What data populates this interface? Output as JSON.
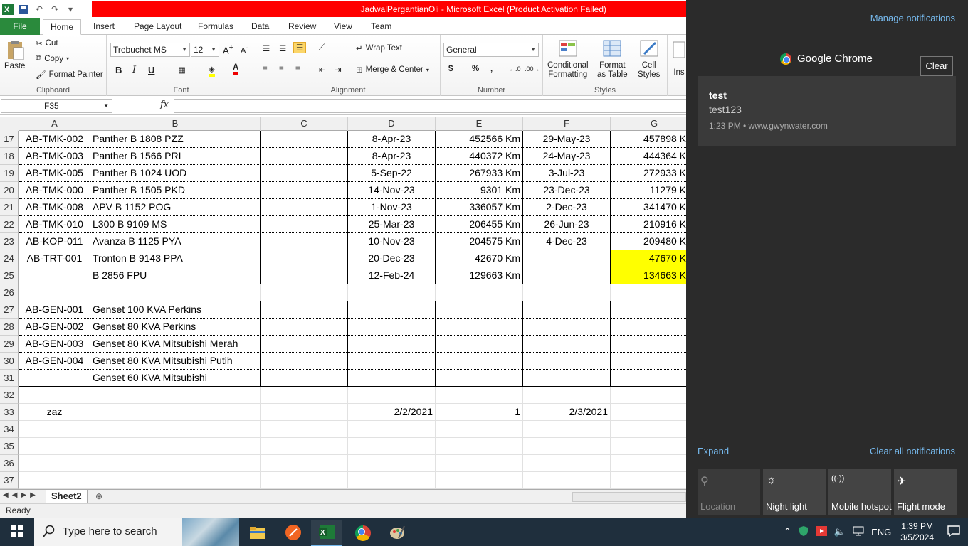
{
  "excel": {
    "title": "JadwalPergantianOli  -  Microsoft Excel (Product Activation Failed)",
    "tabs": [
      "File",
      "Home",
      "Insert",
      "Page Layout",
      "Formulas",
      "Data",
      "Review",
      "View",
      "Team"
    ],
    "clipboard": {
      "paste": "Paste",
      "cut": "Cut",
      "copy": "Copy",
      "format_painter": "Format Painter",
      "label": "Clipboard"
    },
    "font": {
      "family": "Trebuchet MS",
      "size": "12",
      "label": "Font"
    },
    "alignment": {
      "wrap": "Wrap Text",
      "merge": "Merge & Center",
      "label": "Alignment"
    },
    "number": {
      "format": "General",
      "label": "Number"
    },
    "styles": {
      "conditional": "Conditional",
      "formatting": "Formatting",
      "format_as": "Format",
      "as_table": "as Table",
      "cell": "Cell",
      "cell_styles": "Styles",
      "label": "Styles",
      "ins": "Ins"
    },
    "name_box": "F35",
    "fx": "fx",
    "columns": [
      "A",
      "B",
      "C",
      "D",
      "E",
      "F",
      "G"
    ],
    "rows": [
      {
        "n": "17",
        "a": "AB-TMK-002",
        "b": "Panther B 1808 PZZ",
        "c": "",
        "d": "8-Apr-23",
        "e": "452566 Km",
        "f": "29-May-23",
        "g": "457898 K",
        "hl": false,
        "boxed": true
      },
      {
        "n": "18",
        "a": "AB-TMK-003",
        "b": "Panther B 1566 PRI",
        "c": "",
        "d": "8-Apr-23",
        "e": "440372 Km",
        "f": "24-May-23",
        "g": "444364 K",
        "hl": false,
        "boxed": true
      },
      {
        "n": "19",
        "a": "AB-TMK-005",
        "b": "Panther B 1024 UOD",
        "c": "",
        "d": "5-Sep-22",
        "e": "267933 Km",
        "f": "3-Jul-23",
        "g": "272933 K",
        "hl": false,
        "boxed": true
      },
      {
        "n": "20",
        "a": "AB-TMK-000",
        "b": "Panther B 1505 PKD",
        "c": "",
        "d": "14-Nov-23",
        "e": "9301 Km",
        "f": "23-Dec-23",
        "g": "11279 K",
        "hl": false,
        "boxed": true
      },
      {
        "n": "21",
        "a": "AB-TMK-008",
        "b": "APV B 1152 POG",
        "c": "",
        "d": "1-Nov-23",
        "e": "336057 Km",
        "f": "2-Dec-23",
        "g": "341470 K",
        "hl": false,
        "boxed": true
      },
      {
        "n": "22",
        "a": "AB-TMK-010",
        "b": "L300 B 9109 MS",
        "c": "",
        "d": "25-Mar-23",
        "e": "206455 Km",
        "f": "26-Jun-23",
        "g": "210916 K",
        "hl": false,
        "boxed": true
      },
      {
        "n": "23",
        "a": "AB-KOP-011",
        "b": "Avanza B 1125 PYA",
        "c": "",
        "d": "10-Nov-23",
        "e": "204575 Km",
        "f": "4-Dec-23",
        "g": "209480 K",
        "hl": false,
        "boxed": true
      },
      {
        "n": "24",
        "a": "AB-TRT-001",
        "b": "Tronton B 9143 PPA",
        "c": "",
        "d": "20-Dec-23",
        "e": "42670 Km",
        "f": "",
        "g": "47670 K",
        "hl": true,
        "boxed": true
      },
      {
        "n": "25",
        "a": "",
        "b": "B 2856 FPU",
        "c": "",
        "d": "12-Feb-24",
        "e": "129663 Km",
        "f": "",
        "g": "134663 K",
        "hl": true,
        "boxed": true,
        "last": true
      },
      {
        "n": "26",
        "a": "",
        "b": "",
        "c": "",
        "d": "",
        "e": "",
        "f": "",
        "g": "",
        "hl": false,
        "boxed": false
      },
      {
        "n": "27",
        "a": "AB-GEN-001",
        "b": "Genset 100 KVA Perkins",
        "c": "",
        "d": "",
        "e": "",
        "f": "",
        "g": "",
        "hl": false,
        "boxed": true
      },
      {
        "n": "28",
        "a": "AB-GEN-002",
        "b": "Genset 80 KVA Perkins",
        "c": "",
        "d": "",
        "e": "",
        "f": "",
        "g": "",
        "hl": false,
        "boxed": true
      },
      {
        "n": "29",
        "a": "AB-GEN-003",
        "b": "Genset 80 KVA Mitsubishi Merah",
        "c": "",
        "d": "",
        "e": "",
        "f": "",
        "g": "",
        "hl": false,
        "boxed": true
      },
      {
        "n": "30",
        "a": "AB-GEN-004",
        "b": "Genset 80 KVA Mitsubishi Putih",
        "c": "",
        "d": "",
        "e": "",
        "f": "",
        "g": "",
        "hl": false,
        "boxed": true
      },
      {
        "n": "31",
        "a": "",
        "b": "Genset 60 KVA Mitsubishi",
        "c": "",
        "d": "",
        "e": "",
        "f": "",
        "g": "",
        "hl": false,
        "boxed": true,
        "last": true
      },
      {
        "n": "32",
        "a": "",
        "b": "",
        "c": "",
        "d": "",
        "e": "",
        "f": "",
        "g": "",
        "hl": false,
        "boxed": false
      },
      {
        "n": "33",
        "a": "zaz",
        "b": "",
        "c": "",
        "d": "2/2/2021",
        "e": "1",
        "f": "2/3/2021",
        "g": "",
        "hl": false,
        "boxed": false
      },
      {
        "n": "34",
        "a": "",
        "b": "",
        "c": "",
        "d": "",
        "e": "",
        "f": "",
        "g": "",
        "hl": false,
        "boxed": false
      },
      {
        "n": "35",
        "a": "",
        "b": "",
        "c": "",
        "d": "",
        "e": "",
        "f": "",
        "g": "",
        "hl": false,
        "boxed": false
      },
      {
        "n": "36",
        "a": "",
        "b": "",
        "c": "",
        "d": "",
        "e": "",
        "f": "",
        "g": "",
        "hl": false,
        "boxed": false
      },
      {
        "n": "37",
        "a": "",
        "b": "",
        "c": "",
        "d": "",
        "e": "",
        "f": "",
        "g": "",
        "hl": false,
        "boxed": false
      }
    ],
    "sheet_tab": "Sheet2",
    "status": "Ready"
  },
  "action_center": {
    "manage": "Manage notifications",
    "app_name": "Google Chrome",
    "clear": "Clear",
    "notification": {
      "title": "test",
      "body": "test123",
      "meta": "1:23 PM • www.gwynwater.com"
    },
    "expand": "Expand",
    "clear_all": "Clear all notifications",
    "quick_actions": [
      {
        "label": "Location",
        "icon": "location-icon",
        "disabled": true
      },
      {
        "label": "Night light",
        "icon": "night-light-icon",
        "disabled": false
      },
      {
        "label": "Mobile hotspot",
        "icon": "hotspot-icon",
        "disabled": false
      },
      {
        "label": "Flight mode",
        "icon": "airplane-icon",
        "disabled": false
      }
    ]
  },
  "taskbar": {
    "search_placeholder": "Type here to search",
    "language": "ENG",
    "time": "1:39 PM",
    "date": "3/5/2024"
  },
  "colors": {
    "excel_green": "#2a8a3c",
    "title_red": "#ff0000",
    "highlight": "#ffff00",
    "action_center_bg": "#2b2b2b",
    "link_blue": "#76b9ed",
    "taskbar": "#1f2f3d"
  }
}
